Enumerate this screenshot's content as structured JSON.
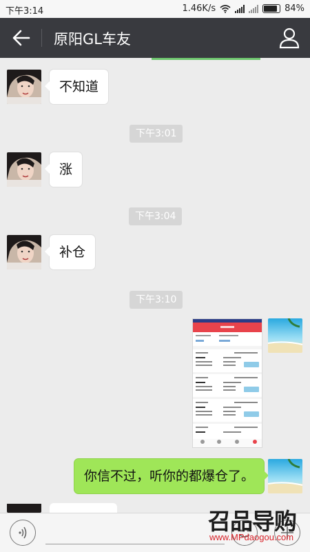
{
  "status_bar": {
    "time": "下午3:14",
    "network_speed": "1.46K/s",
    "battery": "84%"
  },
  "header": {
    "title": "原阳GL车友"
  },
  "messages": [
    {
      "type": "text",
      "side": "left",
      "text": "不知道"
    },
    {
      "type": "timestamp",
      "text": "下午3:01"
    },
    {
      "type": "text",
      "side": "left",
      "text": "涨"
    },
    {
      "type": "timestamp",
      "text": "下午3:04"
    },
    {
      "type": "text",
      "side": "left",
      "text": "补仓"
    },
    {
      "type": "timestamp",
      "text": "下午3:10"
    },
    {
      "type": "image",
      "side": "right",
      "description_icon": "screenshot-thumbnail"
    },
    {
      "type": "text",
      "side": "right",
      "text": "你信不过，听你的都爆仓了。"
    }
  ],
  "watermark": {
    "logo_text": "召品导购",
    "url": "www.MPdaogou.com"
  },
  "colors": {
    "title_bar": "#393a3f",
    "chat_bg": "#ececec",
    "outgoing_bubble": "#9fe658",
    "timestamp_bg": "#d6d6d6"
  }
}
